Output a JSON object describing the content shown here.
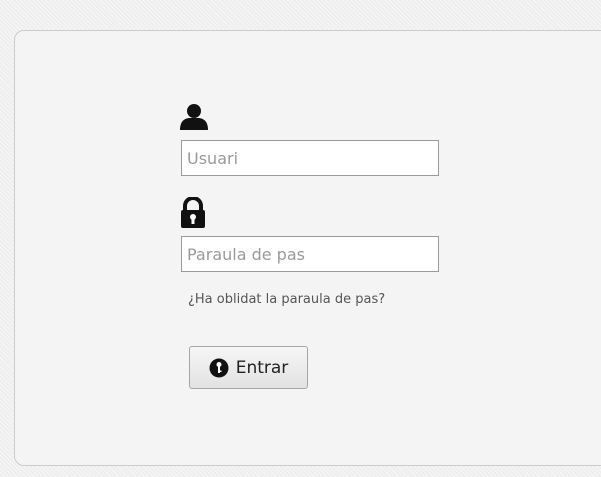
{
  "login_form": {
    "username": {
      "placeholder": "Usuari",
      "value": "",
      "icon": "user-icon"
    },
    "password": {
      "placeholder": "Paraula de pas",
      "value": "",
      "icon": "lock-icon"
    },
    "forgot_password_label": "¿Ha oblidat la paraula de pas?",
    "submit": {
      "label": "Entrar",
      "icon": "key-icon"
    }
  },
  "colors": {
    "page_background": "#eeeeee",
    "panel_background": "#f4f4f4",
    "icon": "#111111",
    "link": "#555555"
  }
}
